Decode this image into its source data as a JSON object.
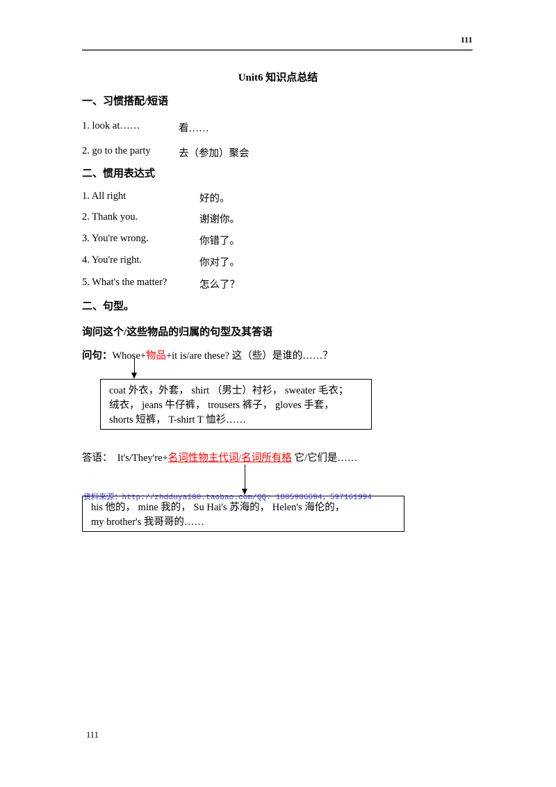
{
  "header": {
    "page_number": "111"
  },
  "title": "Unit6  知识点总结",
  "section1": {
    "heading": "一、习惯搭配/短语",
    "items": [
      {
        "english": "1. look at……",
        "chinese": "看……"
      },
      {
        "english": "2. go to the party",
        "chinese": "去（参加）聚会"
      }
    ]
  },
  "section2": {
    "heading": "二、惯用表达式",
    "items": [
      {
        "english": "1. All right",
        "chinese": "好的。"
      },
      {
        "english": "2. Thank you.",
        "chinese": "谢谢你。"
      },
      {
        "english": "3. You're wrong.",
        "chinese": "你错了。"
      },
      {
        "english": "4. You're right.",
        "chinese": "你对了。"
      },
      {
        "english": "5. What's the matter?",
        "chinese": "怎么了？"
      }
    ]
  },
  "section3": {
    "heading": "二、句型。",
    "subheading": "询问这个/这些物品的归属的句型及其答语",
    "question": {
      "label": "问句：",
      "before_red": "Whose+",
      "red": "物品",
      "after_red": "+it is/are these?  这（些）是谁的……？"
    },
    "items_box": {
      "lines": [
        "coat 外衣，外套，  shirt （男士）衬衫，  sweater 毛衣；",
        "绒衣， jeans 牛仔裤，  trousers 裤子，  gloves 手套，",
        "shorts 短裤，  T-shirt T 恤衫……"
      ]
    },
    "answer": {
      "label": "答语：",
      "before_red": "It's/They're+",
      "red": "名词性物主代词/名词所有格",
      "after_red": " 它/它们是……"
    },
    "possessive_box": {
      "lines": [
        "his 他的，  mine 我的，  Su Hai's 苏海的，  Helen's 海伦的，",
        "my brother's 我哥哥的……"
      ]
    }
  },
  "watermark": "资料来源：http://zhdduya100.taobao.com/QQ: 1805986694，597161994",
  "footer": {
    "page_number": "111"
  },
  "colors": {
    "red_accent": "#ff0000",
    "watermark_blue": "#3a3ad0",
    "rule_gray": "#59595b"
  }
}
